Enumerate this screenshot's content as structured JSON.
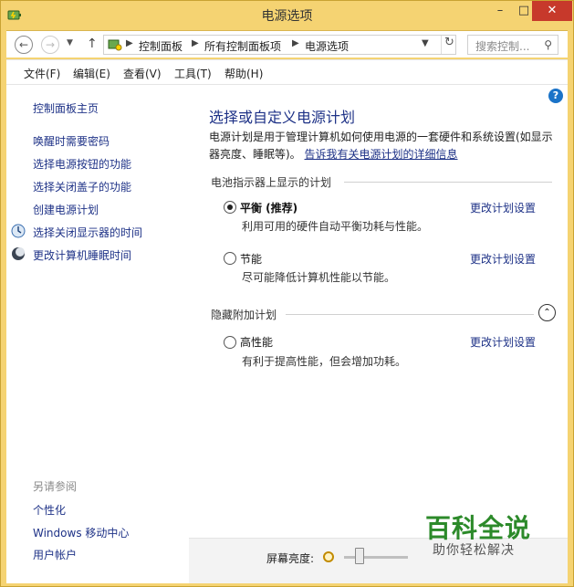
{
  "window": {
    "title": "电源选项",
    "controls": {
      "minimize": "–",
      "maximize": "□",
      "close": "✕"
    }
  },
  "navigation": {
    "breadcrumbs": [
      "控制面板",
      "所有控制面板项",
      "电源选项"
    ],
    "search_placeholder": "搜索控制..."
  },
  "menu": [
    "文件(F)",
    "编辑(E)",
    "查看(V)",
    "工具(T)",
    "帮助(H)"
  ],
  "sidebar": {
    "home": "控制面板主页",
    "items": [
      "唤醒时需要密码",
      "选择电源按钮的功能",
      "选择关闭盖子的功能",
      "创建电源计划",
      "选择关闭显示器的时间",
      "更改计算机睡眠时间"
    ],
    "see_also_title": "另请参阅",
    "see_also": [
      "个性化",
      "Windows 移动中心",
      "用户帐户"
    ]
  },
  "main": {
    "title": "选择或自定义电源计划",
    "description": "电源计划是用于管理计算机如何使用电源的一套硬件和系统设置(如显示器亮度、睡眠等)。",
    "description_link": "告诉我有关电源计划的详细信息",
    "battery_group": "电池指示器上显示的计划",
    "hidden_group": "隐藏附加计划",
    "plans": [
      {
        "name": "平衡 (推荐)",
        "desc": "利用可用的硬件自动平衡功耗与性能。",
        "selected": true,
        "link": "更改计划设置"
      },
      {
        "name": "节能",
        "desc": "尽可能降低计算机性能以节能。",
        "selected": false,
        "link": "更改计划设置"
      },
      {
        "name": "高性能",
        "desc": "有利于提高性能，但会增加功耗。",
        "selected": false,
        "link": "更改计划设置"
      }
    ]
  },
  "footer": {
    "brightness_label": "屏幕亮度:"
  },
  "watermark": {
    "title": "百科全说",
    "subtitle": "助你轻松解决"
  },
  "colors": {
    "titlebar": "#f5d372",
    "link": "#1e3287",
    "close": "#c7392b",
    "watermark": "#2c8a2a"
  }
}
